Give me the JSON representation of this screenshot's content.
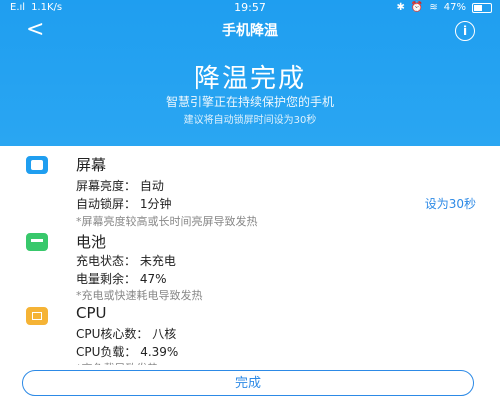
{
  "status_bar": {
    "signal": "E.ıl",
    "speed": "1.1K/s",
    "time": "19:57",
    "battery_text": "47%",
    "battery_level": 0.47
  },
  "navbar": {
    "back_glyph": "<",
    "title": "手机降温",
    "info_glyph": "i"
  },
  "hero": {
    "title": "降温完成",
    "subtitle": "智慧引擎正在持续保护您的手机",
    "tip": "建议将自动锁屏时间设为30秒"
  },
  "sections": {
    "screen": {
      "title": "屏幕",
      "lines": [
        "屏幕亮度：  自动",
        "自动锁屏：  1分钟"
      ],
      "action": "设为30秒",
      "note": "*屏幕亮度较高或长时间亮屏导致发热"
    },
    "battery": {
      "title": "电池",
      "lines": [
        "充电状态：  未充电",
        "电量剩余：  47%"
      ],
      "note": "*充电或快速耗电导致发热"
    },
    "cpu": {
      "title": "CPU",
      "lines": [
        "CPU核心数：  八核",
        "CPU负载：  4.39%"
      ],
      "note": "*高负载导致发热"
    }
  },
  "footer": {
    "done_label": "完成"
  },
  "colors": {
    "accent": "#1f9ef0",
    "link": "#2d8ae6",
    "battery_green": "#38c86b",
    "cpu_yellow": "#f5b335"
  }
}
